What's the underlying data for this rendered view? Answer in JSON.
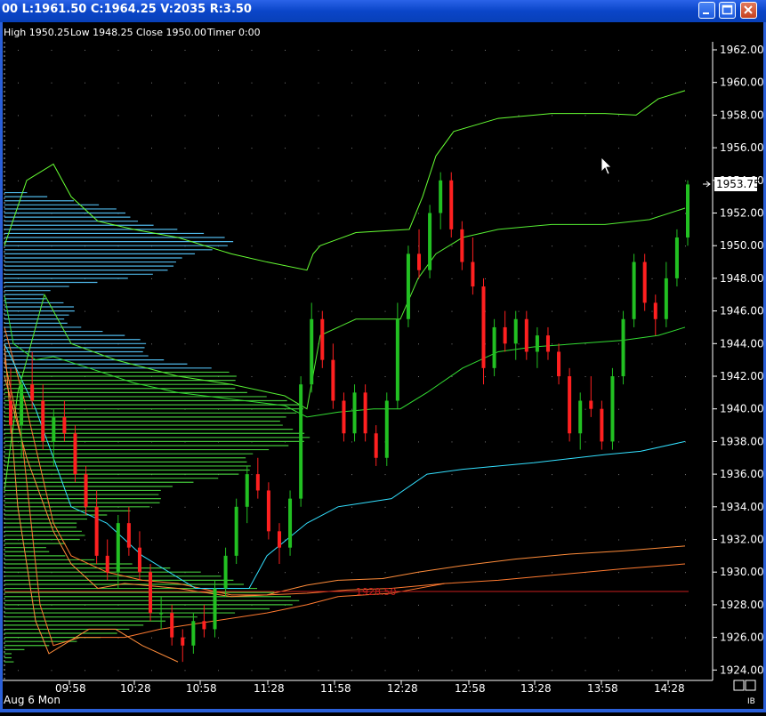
{
  "window": {
    "title": "00 L:1961.50 C:1964.25 V:2035 R:3.50",
    "minimize_icon": "minimize-icon",
    "maximize_icon": "maximize-icon",
    "close_icon": "close-icon"
  },
  "info_bar": {
    "high": "High 1950.25",
    "low": "Low 1948.25",
    "close": "Close 1950.00",
    "timer": "Timer 0:00"
  },
  "date_label": "Aug 6 Mon",
  "corner_label": "IB",
  "last_price_label": "1953.75",
  "level_label": "1928.50",
  "colors": {
    "up_candle": "#22c022",
    "down_candle": "#ff2020",
    "volume_upper": "#4fb7e8",
    "volume_lower": "#43c43a",
    "band": "#66ff33",
    "cyan_line": "#33e0ff",
    "orange_line": "#ff8c3a",
    "level_line": "#c81e1e"
  },
  "chart_data": {
    "type": "candlestick",
    "x_ticks": [
      "09:58",
      "10:28",
      "10:58",
      "11:28",
      "11:58",
      "12:28",
      "12:58",
      "13:28",
      "13:58",
      "14:28"
    ],
    "y_ticks": [
      "1962.00",
      "1960.00",
      "1958.00",
      "1956.00",
      "1954.00",
      "1952.00",
      "1950.00",
      "1948.00",
      "1946.00",
      "1944.00",
      "1942.00",
      "1940.00",
      "1938.00",
      "1936.00",
      "1934.00",
      "1932.00",
      "1930.00",
      "1928.00",
      "1926.00",
      "1924.00"
    ],
    "ylim": [
      1923.8,
      1962.4
    ],
    "candles": [
      [
        1940.5,
        1942.5,
        1938.5,
        1939.0
      ],
      [
        1939.0,
        1942.0,
        1937.0,
        1941.5
      ],
      [
        1941.5,
        1943.5,
        1940.0,
        1940.5
      ],
      [
        1940.5,
        1941.5,
        1937.5,
        1938.0
      ],
      [
        1938.0,
        1940.0,
        1936.5,
        1939.5
      ],
      [
        1939.5,
        1940.5,
        1938.0,
        1938.5
      ],
      [
        1938.5,
        1939.0,
        1935.5,
        1936.0
      ],
      [
        1936.0,
        1936.5,
        1933.5,
        1934.0
      ],
      [
        1934.0,
        1935.0,
        1930.5,
        1931.0
      ],
      [
        1931.0,
        1932.0,
        1929.5,
        1930.0
      ],
      [
        1930.0,
        1933.5,
        1929.0,
        1933.0
      ],
      [
        1933.0,
        1934.0,
        1931.0,
        1931.5
      ],
      [
        1931.5,
        1932.5,
        1929.5,
        1930.0
      ],
      [
        1930.0,
        1930.5,
        1927.0,
        1927.5
      ],
      [
        1927.5,
        1928.5,
        1926.5,
        1927.5
      ],
      [
        1927.5,
        1928.0,
        1925.5,
        1926.0
      ],
      [
        1926.0,
        1926.5,
        1924.5,
        1925.5
      ],
      [
        1925.5,
        1927.5,
        1925.0,
        1927.0
      ],
      [
        1927.0,
        1928.0,
        1926.0,
        1926.5
      ],
      [
        1926.5,
        1929.5,
        1926.0,
        1929.0
      ],
      [
        1929.0,
        1931.5,
        1928.5,
        1931.0
      ],
      [
        1931.0,
        1934.5,
        1930.5,
        1934.0
      ],
      [
        1934.0,
        1936.5,
        1933.0,
        1936.0
      ],
      [
        1936.0,
        1937.0,
        1934.5,
        1935.0
      ],
      [
        1935.0,
        1935.5,
        1932.0,
        1932.5
      ],
      [
        1932.5,
        1933.0,
        1930.5,
        1931.5
      ],
      [
        1931.5,
        1935.0,
        1931.0,
        1934.5
      ],
      [
        1934.5,
        1942.0,
        1934.0,
        1941.5
      ],
      [
        1941.5,
        1946.5,
        1941.0,
        1945.5
      ],
      [
        1945.5,
        1946.0,
        1942.5,
        1943.0
      ],
      [
        1943.0,
        1944.0,
        1940.0,
        1940.5
      ],
      [
        1940.5,
        1941.0,
        1938.0,
        1938.5
      ],
      [
        1938.5,
        1941.5,
        1938.0,
        1941.0
      ],
      [
        1941.0,
        1941.5,
        1938.0,
        1938.5
      ],
      [
        1938.5,
        1939.0,
        1936.5,
        1937.0
      ],
      [
        1937.0,
        1941.0,
        1936.5,
        1940.5
      ],
      [
        1940.5,
        1946.5,
        1940.0,
        1945.5
      ],
      [
        1945.5,
        1950.0,
        1945.0,
        1949.5
      ],
      [
        1949.5,
        1951.0,
        1948.0,
        1948.5
      ],
      [
        1948.5,
        1952.5,
        1948.0,
        1952.0
      ],
      [
        1952.0,
        1954.5,
        1951.0,
        1954.0
      ],
      [
        1954.0,
        1954.5,
        1950.5,
        1951.0
      ],
      [
        1951.0,
        1951.5,
        1948.5,
        1949.0
      ],
      [
        1949.0,
        1950.5,
        1947.0,
        1947.5
      ],
      [
        1947.5,
        1948.0,
        1941.5,
        1942.5
      ],
      [
        1942.5,
        1945.5,
        1942.0,
        1945.0
      ],
      [
        1945.0,
        1946.0,
        1943.5,
        1944.0
      ],
      [
        1944.0,
        1946.0,
        1943.0,
        1945.5
      ],
      [
        1945.5,
        1946.0,
        1943.0,
        1943.5
      ],
      [
        1943.5,
        1945.0,
        1942.5,
        1944.5
      ],
      [
        1944.5,
        1945.0,
        1943.0,
        1943.5
      ],
      [
        1943.5,
        1944.0,
        1941.5,
        1942.0
      ],
      [
        1942.0,
        1942.5,
        1938.0,
        1938.5
      ],
      [
        1938.5,
        1941.0,
        1937.5,
        1940.5
      ],
      [
        1940.5,
        1942.0,
        1939.5,
        1940.0
      ],
      [
        1940.0,
        1940.5,
        1937.5,
        1938.0
      ],
      [
        1938.0,
        1942.5,
        1937.5,
        1942.0
      ],
      [
        1942.0,
        1946.0,
        1941.5,
        1945.5
      ],
      [
        1945.5,
        1949.5,
        1945.0,
        1949.0
      ],
      [
        1949.0,
        1949.5,
        1946.0,
        1946.5
      ],
      [
        1946.5,
        1947.0,
        1944.5,
        1945.5
      ],
      [
        1945.5,
        1949.0,
        1945.0,
        1948.0
      ],
      [
        1948.0,
        1951.0,
        1947.5,
        1950.5
      ],
      [
        1950.5,
        1954.0,
        1950.0,
        1953.75
      ]
    ],
    "level": 1928.5,
    "last_price": 1953.75
  }
}
